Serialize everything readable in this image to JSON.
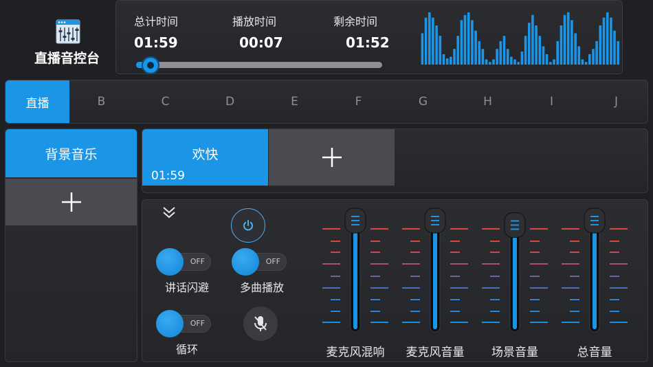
{
  "app": {
    "title": "直播音控台"
  },
  "times": {
    "total_label": "总计时间",
    "total_value": "01:59",
    "played_label": "播放时间",
    "played_value": "00:07",
    "remaining_label": "剩余时间",
    "remaining_value": "01:52"
  },
  "progress": {
    "fraction": 0.06
  },
  "spectrum": {
    "levels": [
      0.6,
      0.9,
      1.0,
      0.9,
      0.75,
      0.55,
      0.2,
      0.12,
      0.15,
      0.3,
      0.55,
      0.85,
      0.95,
      1.0,
      0.85,
      0.65,
      0.45,
      0.3,
      0.1,
      0.05,
      0.1,
      0.3,
      0.45,
      0.55,
      0.3,
      0.15,
      0.1,
      0.05,
      0.25,
      0.55,
      0.8,
      0.95,
      0.75,
      0.55,
      0.35,
      0.2,
      0.05,
      0.1,
      0.45,
      0.75,
      0.95,
      1.0,
      0.85,
      0.6,
      0.35,
      0.1,
      0.05,
      0.2,
      0.3,
      0.45,
      0.75,
      0.9,
      1.0,
      0.9,
      0.65,
      0.45
    ]
  },
  "tabs": [
    {
      "label": "直播",
      "active": true
    },
    {
      "label": "B"
    },
    {
      "label": "C"
    },
    {
      "label": "D"
    },
    {
      "label": "E"
    },
    {
      "label": "F"
    },
    {
      "label": "G"
    },
    {
      "label": "H"
    },
    {
      "label": "I"
    },
    {
      "label": "J"
    }
  ],
  "left": {
    "category": "背景音乐"
  },
  "tracks": [
    {
      "title": "欢快",
      "duration": "01:59"
    }
  ],
  "toggles": {
    "ducking": {
      "label": "讲话闪避",
      "state": "OFF"
    },
    "multi": {
      "label": "多曲播放",
      "state": "OFF"
    },
    "loop": {
      "label": "循环",
      "state": "OFF"
    }
  },
  "faders": [
    {
      "label": "麦克风混响",
      "level": 1.0
    },
    {
      "label": "麦克风音量",
      "level": 1.0
    },
    {
      "label": "场景音量",
      "level": 0.96
    },
    {
      "label": "总音量",
      "level": 1.0
    }
  ],
  "colors": {
    "accent": "#1b95e6",
    "background": "#1f2024"
  }
}
